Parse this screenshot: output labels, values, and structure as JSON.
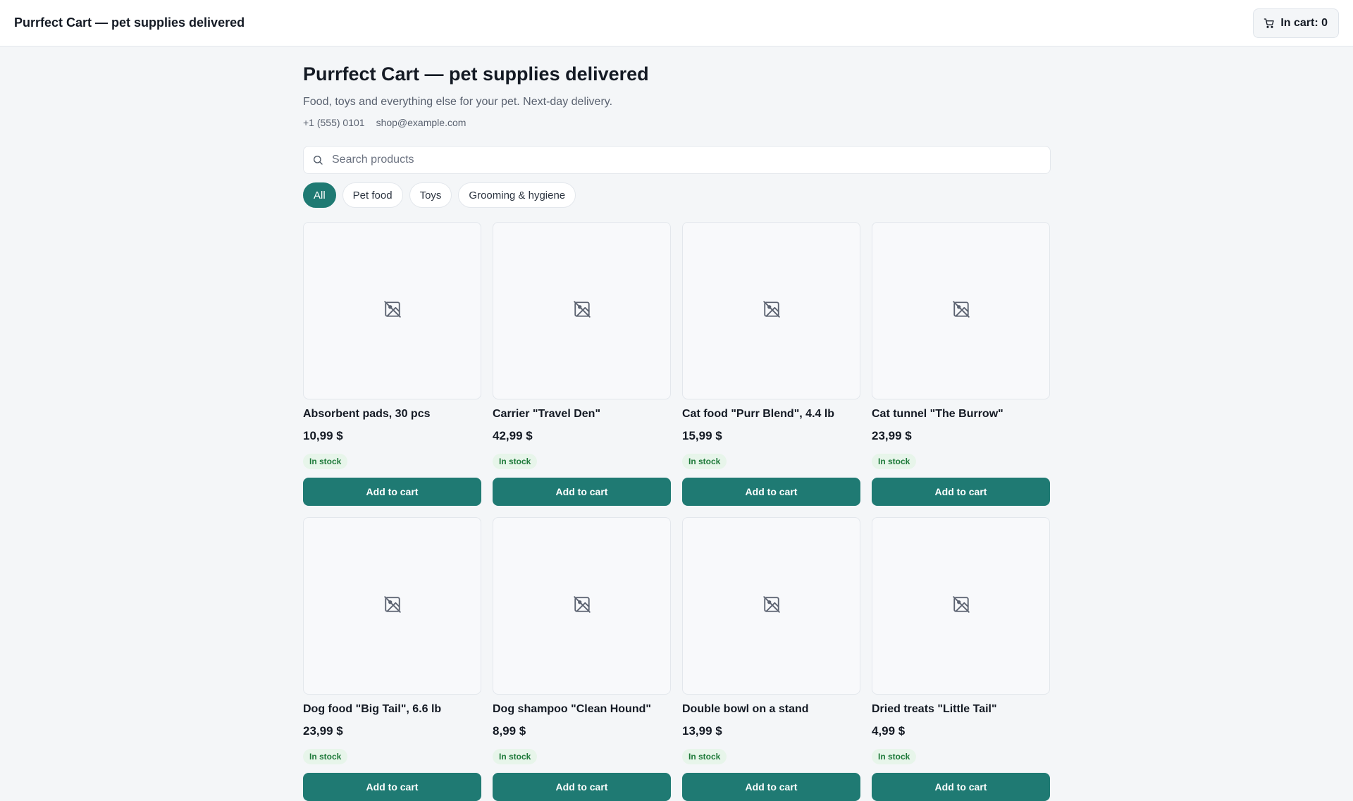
{
  "header": {
    "brand": "Purrfect Cart — pet supplies delivered",
    "cart_label": "In cart: 0",
    "cart_icon": "cart-icon"
  },
  "page": {
    "title": "Purrfect Cart — pet supplies delivered",
    "subtitle": "Food, toys and everything else for your pet. Next-day delivery.",
    "phone": "+1 (555) 0101",
    "email": "shop@example.com"
  },
  "search": {
    "placeholder": "Search products",
    "value": "",
    "icon": "search-icon"
  },
  "filters": [
    {
      "label": "All",
      "active": true
    },
    {
      "label": "Pet food",
      "active": false
    },
    {
      "label": "Toys",
      "active": false
    },
    {
      "label": "Grooming & hygiene",
      "active": false
    }
  ],
  "products": [
    {
      "name": "Absorbent pads, 30 pcs",
      "price": "10,99 $",
      "stock": "In stock",
      "button": "Add to cart",
      "image_icon": "image-unavailable-icon"
    },
    {
      "name": "Carrier \"Travel Den\"",
      "price": "42,99 $",
      "stock": "In stock",
      "button": "Add to cart",
      "image_icon": "image-unavailable-icon"
    },
    {
      "name": "Cat food \"Purr Blend\", 4.4 lb",
      "price": "15,99 $",
      "stock": "In stock",
      "button": "Add to cart",
      "image_icon": "image-unavailable-icon"
    },
    {
      "name": "Cat tunnel \"The Burrow\"",
      "price": "23,99 $",
      "stock": "In stock",
      "button": "Add to cart",
      "image_icon": "image-unavailable-icon"
    },
    {
      "name": "Dog food \"Big Tail\", 6.6 lb",
      "price": "23,99 $",
      "stock": "In stock",
      "button": "Add to cart",
      "image_icon": "image-unavailable-icon"
    },
    {
      "name": "Dog shampoo \"Clean Hound\"",
      "price": "8,99 $",
      "stock": "In stock",
      "button": "Add to cart",
      "image_icon": "image-unavailable-icon"
    },
    {
      "name": "Double bowl on a stand",
      "price": "13,99 $",
      "stock": "In stock",
      "button": "Add to cart",
      "image_icon": "image-unavailable-icon"
    },
    {
      "name": "Dried treats \"Little Tail\"",
      "price": "4,99 $",
      "stock": "In stock",
      "button": "Add to cart",
      "image_icon": "image-unavailable-icon"
    }
  ],
  "colors": {
    "accent": "#1f7a73",
    "stock_bg": "#e7f5ea",
    "stock_text": "#1e7a3a",
    "page_bg": "#f4f6f8"
  }
}
